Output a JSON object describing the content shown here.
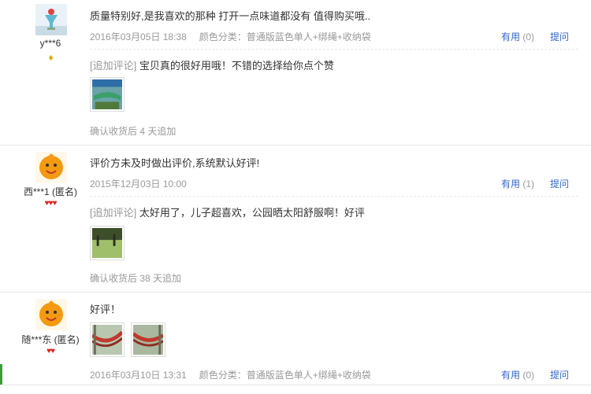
{
  "reviews": [
    {
      "user": "y***6",
      "badge": "♦",
      "content": "质量特别好,是我喜欢的那种 打开一点味道都没有 值得购买哦..",
      "date": "2016年03月05日 18:38",
      "spec": "颜色分类：普通版蓝色单人+绑绳+收纳袋",
      "useful_label": "有用",
      "useful_count": "(0)",
      "ask_label": "提问",
      "append_tag": "[追加评论]",
      "append_text": "宝贝真的很好用哦！不错的选择给你点个赞",
      "confirm": "确认收货后 4 天追加"
    },
    {
      "user": "西***1 (匿名)",
      "badge": "♥♥♥",
      "content": "评价方未及时做出评价,系统默认好评!",
      "date": "2015年12月03日 10:00",
      "useful_label": "有用",
      "useful_count": "(1)",
      "ask_label": "提问",
      "append_tag": "[追加评论]",
      "append_text": "太好用了，儿子超喜欢，公园晒太阳舒服啊！好评",
      "confirm": "确认收货后 38 天追加"
    },
    {
      "user": "随***东 (匿名)",
      "badge": "♥♥",
      "content": "好评！",
      "date": "2016年03月10日 13:31",
      "spec": "颜色分类：普通版蓝色单人+绑绳+收纳袋",
      "useful_label": "有用",
      "useful_count": "(0)",
      "ask_label": "提问"
    }
  ],
  "colors": {
    "link": "#3366cc",
    "muted": "#999999",
    "badge_red": "#d9251c",
    "badge_gold": "#e8a800"
  },
  "icons": [
    "user-avatar-icon",
    "diamond-badge-icon",
    "heart-badge-icon"
  ]
}
